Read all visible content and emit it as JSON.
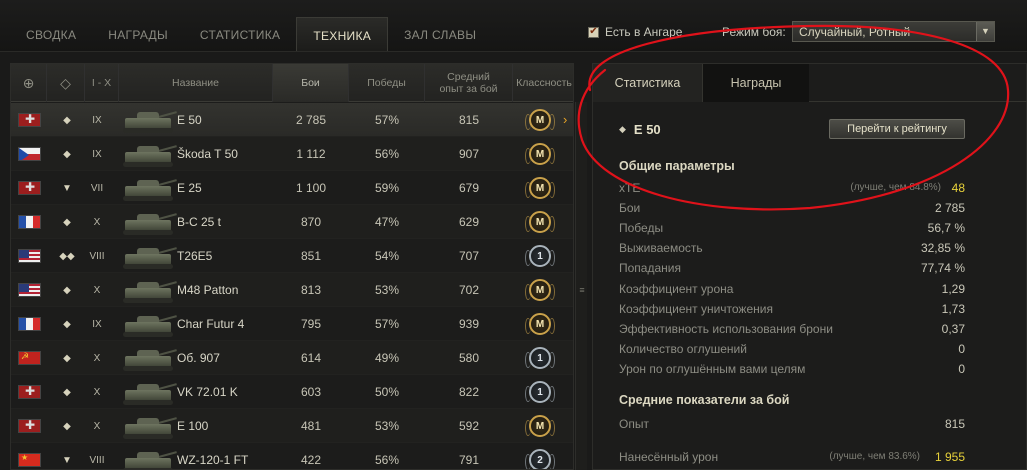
{
  "nav": {
    "tabs": [
      {
        "label": "СВОДКА",
        "active": false
      },
      {
        "label": "НАГРАДЫ",
        "active": false
      },
      {
        "label": "СТАТИСТИКА",
        "active": false
      },
      {
        "label": "ТЕХНИКА",
        "active": true
      },
      {
        "label": "ЗАЛ СЛАВЫ",
        "active": false
      }
    ]
  },
  "filters": {
    "in_hangar_label": "Есть в Ангаре",
    "in_hangar_checked": true,
    "mode_label": "Режим боя:",
    "mode_value": "Случайный, Ротный"
  },
  "table": {
    "headers": {
      "nation_icon": "globe-icon",
      "type_icon": "vehicle-type-icon",
      "tier": "I - X",
      "name": "Название",
      "battles": "Бои",
      "wins": "Победы",
      "avg_xp": "Средний опыт за бой",
      "mastery": "Классность"
    },
    "rows": [
      {
        "nation": "germany",
        "type": "◆",
        "tier": "IX",
        "name": "E 50",
        "battles": "2 785",
        "wins": "57%",
        "avg_xp": "815",
        "mastery": "M",
        "mastery_kind": "gold",
        "selected": true
      },
      {
        "nation": "czech",
        "type": "◆",
        "tier": "IX",
        "name": "Škoda T 50",
        "battles": "1 112",
        "wins": "56%",
        "avg_xp": "907",
        "mastery": "M",
        "mastery_kind": "gold"
      },
      {
        "nation": "germany",
        "type": "▼",
        "tier": "VII",
        "name": "E 25",
        "battles": "1 100",
        "wins": "59%",
        "avg_xp": "679",
        "mastery": "M",
        "mastery_kind": "gold"
      },
      {
        "nation": "france",
        "type": "◆",
        "tier": "X",
        "name": "B-C 25 t",
        "battles": "870",
        "wins": "47%",
        "avg_xp": "629",
        "mastery": "M",
        "mastery_kind": "gold"
      },
      {
        "nation": "usa",
        "type": "◆◆",
        "tier": "VIII",
        "name": "T26E5",
        "battles": "851",
        "wins": "54%",
        "avg_xp": "707",
        "mastery": "1",
        "mastery_kind": "silver"
      },
      {
        "nation": "usa",
        "type": "◆",
        "tier": "X",
        "name": "M48 Patton",
        "battles": "813",
        "wins": "53%",
        "avg_xp": "702",
        "mastery": "M",
        "mastery_kind": "gold"
      },
      {
        "nation": "france",
        "type": "◆",
        "tier": "IX",
        "name": "Char Futur 4",
        "battles": "795",
        "wins": "57%",
        "avg_xp": "939",
        "mastery": "M",
        "mastery_kind": "gold"
      },
      {
        "nation": "ussr",
        "type": "◆",
        "tier": "X",
        "name": "Об. 907",
        "battles": "614",
        "wins": "49%",
        "avg_xp": "580",
        "mastery": "1",
        "mastery_kind": "silver"
      },
      {
        "nation": "germany",
        "type": "◆",
        "tier": "X",
        "name": "VK 72.01 K",
        "battles": "603",
        "wins": "50%",
        "avg_xp": "822",
        "mastery": "1",
        "mastery_kind": "silver"
      },
      {
        "nation": "germany",
        "type": "◆",
        "tier": "X",
        "name": "E 100",
        "battles": "481",
        "wins": "53%",
        "avg_xp": "592",
        "mastery": "M",
        "mastery_kind": "gold"
      },
      {
        "nation": "china",
        "type": "▼",
        "tier": "VIII",
        "name": "WZ-120-1 FT",
        "battles": "422",
        "wins": "56%",
        "avg_xp": "791",
        "mastery": "2",
        "mastery_kind": "silver"
      }
    ]
  },
  "panel": {
    "tabs": [
      {
        "label": "Статистика",
        "active": true
      },
      {
        "label": "Награды",
        "active": false
      }
    ],
    "tank_name": "E 50",
    "rating_button": "Перейти к рейтингу",
    "general_title": "Общие параметры",
    "general": [
      {
        "label": "xTE",
        "note": "(лучше, чем 84.8%)",
        "value": "48",
        "highlight": true
      },
      {
        "label": "Бои",
        "value": "2 785"
      },
      {
        "label": "Победы",
        "value": "56,7 %"
      },
      {
        "label": "Выживаемость",
        "value": "32,85 %"
      },
      {
        "label": "Попадания",
        "value": "77,74 %"
      },
      {
        "label": "Коэффициент урона",
        "value": "1,29"
      },
      {
        "label": "Коэффициент уничтожения",
        "value": "1,73"
      },
      {
        "label": "Эффективность использования брони",
        "value": "0,37"
      },
      {
        "label": "Количество оглушений",
        "value": "0"
      },
      {
        "label": "Урон по оглушённым вами целям",
        "value": "0"
      }
    ],
    "avg_title": "Средние показатели за бой",
    "avg": [
      {
        "label": "Опыт",
        "value": "815"
      },
      {
        "label": "Нанесённый урон",
        "note": "(лучше, чем 83.6%)",
        "value": "1 955",
        "highlight": true
      }
    ]
  },
  "colors": {
    "annotation": "#e0121a",
    "accent": "#e8d23a"
  }
}
